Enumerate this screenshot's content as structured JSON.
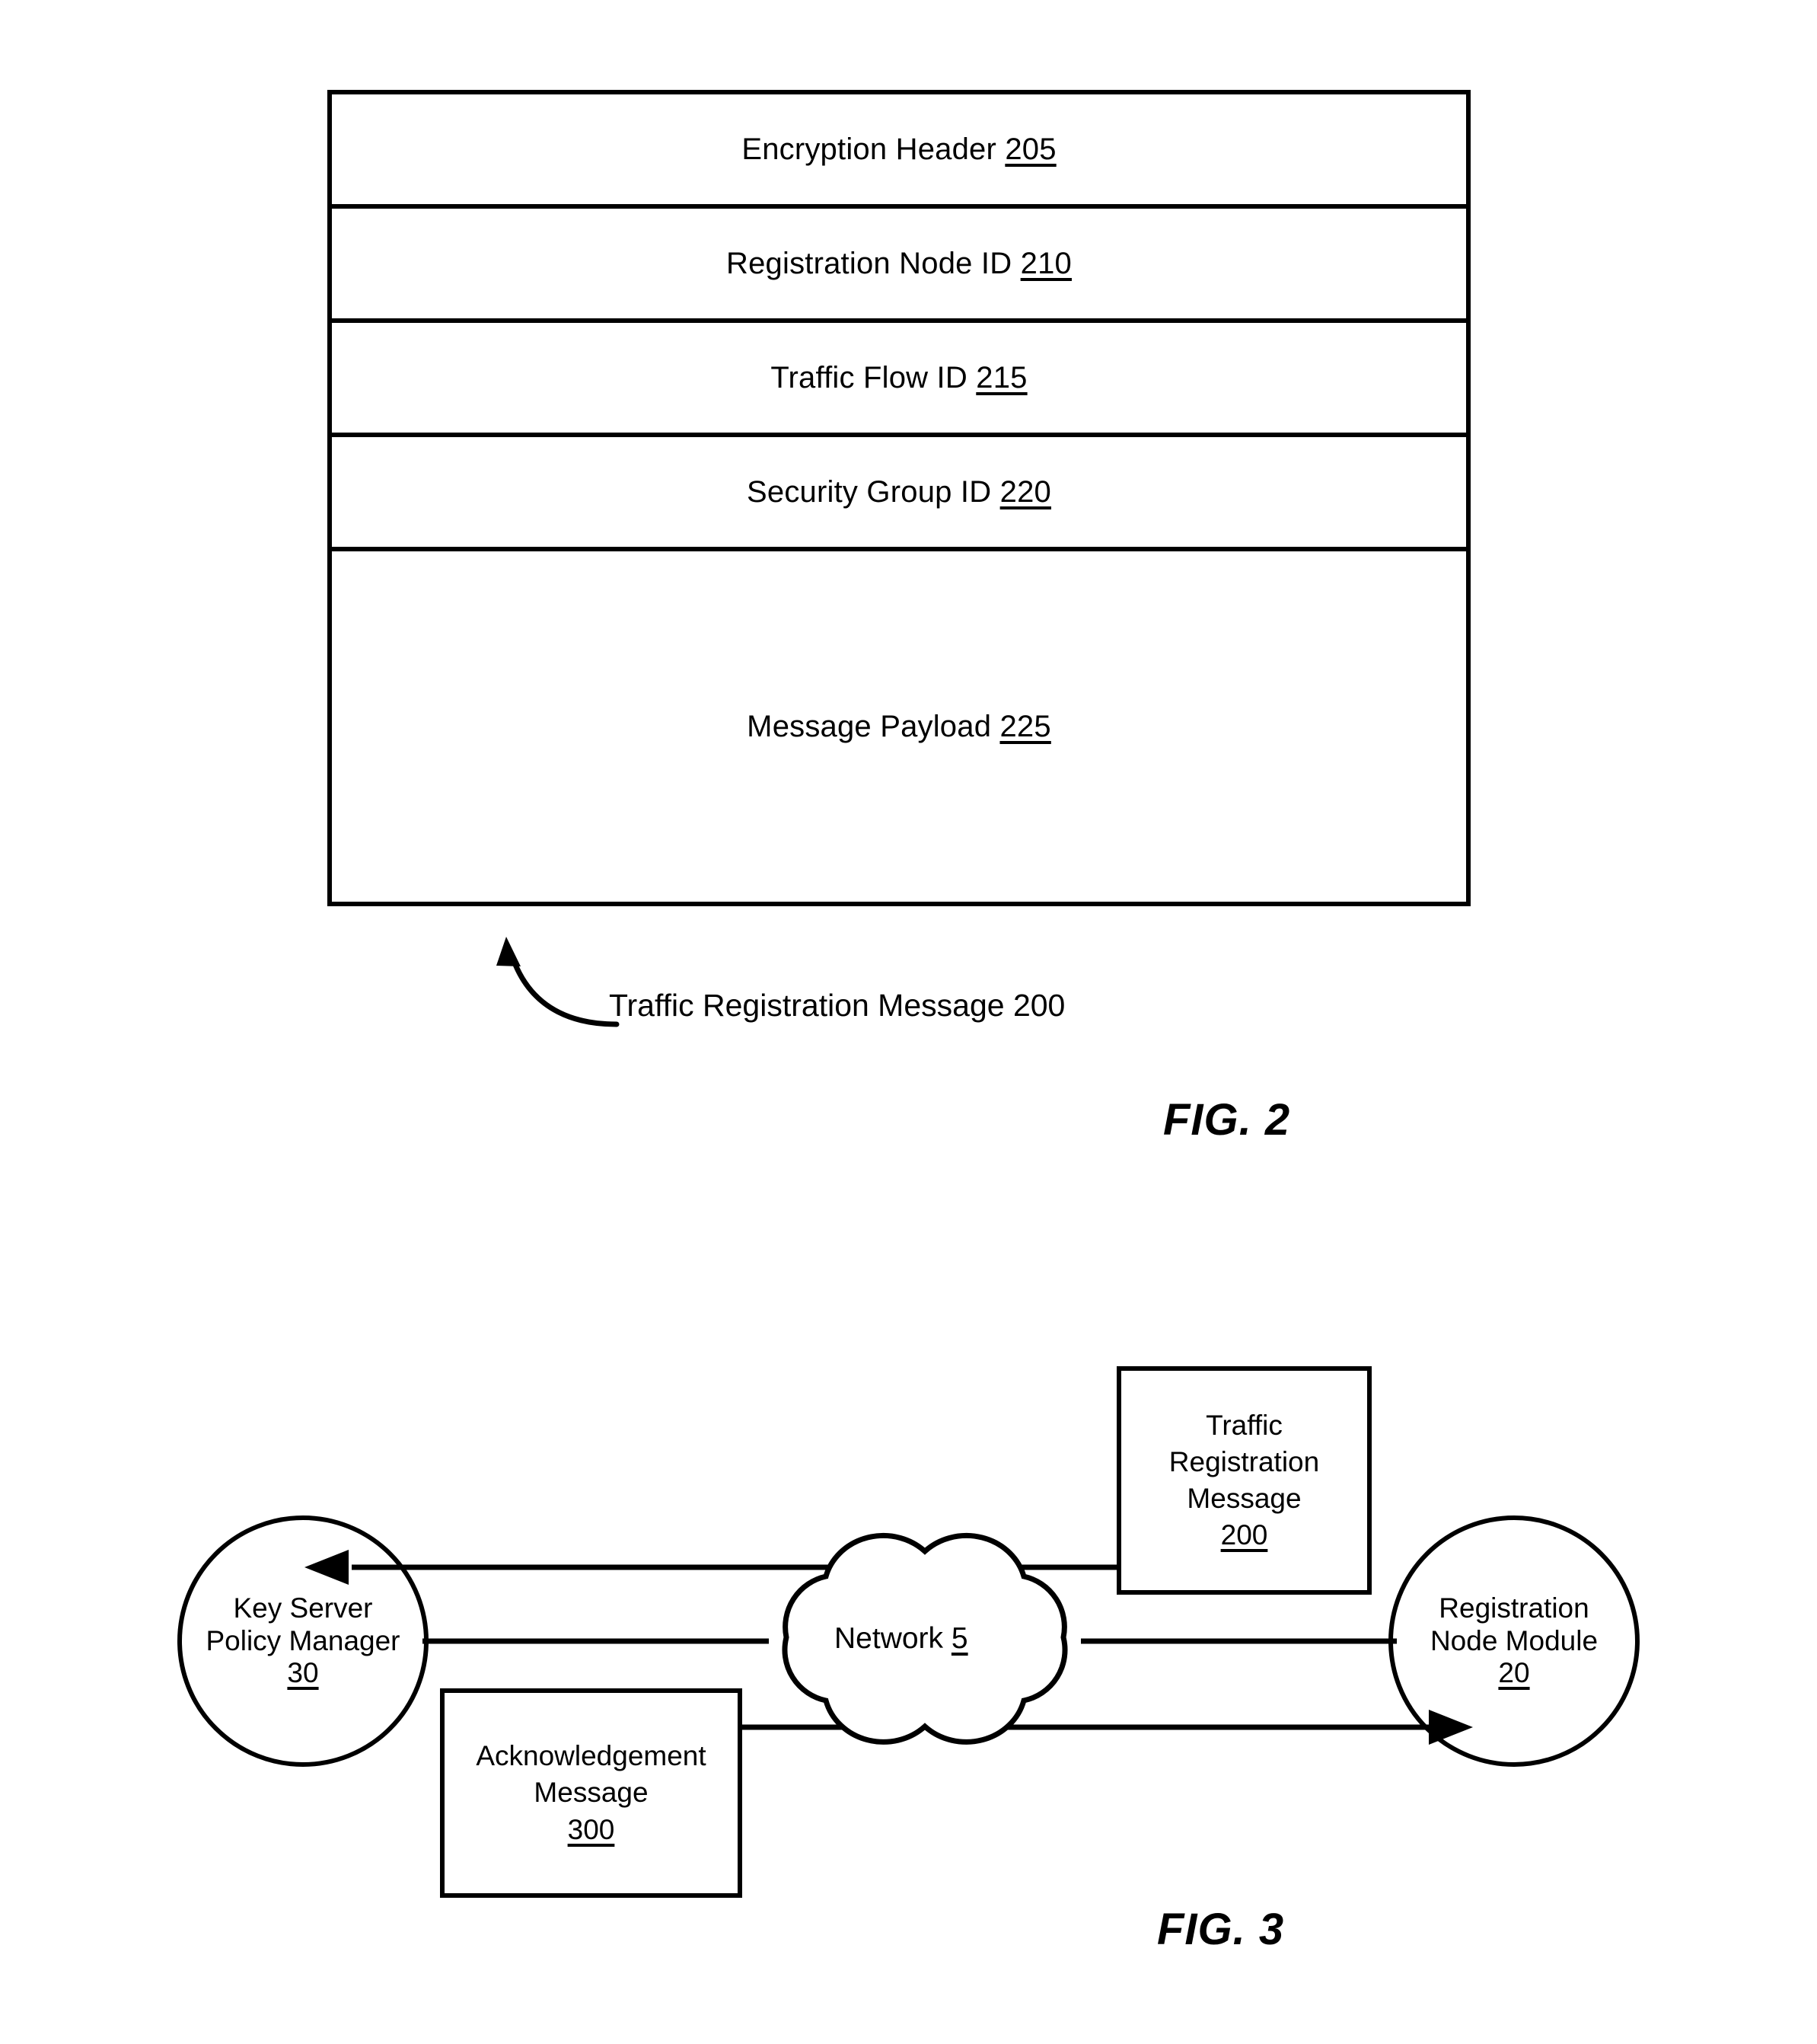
{
  "figure2": {
    "rows": [
      {
        "label": "Encryption Header",
        "ref": "205"
      },
      {
        "label": "Registration Node ID",
        "ref": "210"
      },
      {
        "label": "Traffic Flow ID",
        "ref": "215"
      },
      {
        "label": "Security Group ID",
        "ref": "220"
      },
      {
        "label": "Message Payload",
        "ref": "225"
      }
    ],
    "caption": "Traffic Registration Message 200",
    "fig_label": "FIG. 2"
  },
  "figure3": {
    "key_server": {
      "line1": "Key Server",
      "line2": "Policy Manager",
      "ref": "30"
    },
    "registration_node": {
      "line1": "Registration",
      "line2": "Node Module",
      "ref": "20"
    },
    "network": {
      "label": "Network",
      "ref": "5"
    },
    "traffic_registration_message": {
      "line1": "Traffic",
      "line2": "Registration",
      "line3": "Message",
      "ref": "200"
    },
    "acknowledgement_message": {
      "line1": "Acknowledgement",
      "line2": "Message",
      "ref": "300"
    },
    "fig_label": "FIG. 3"
  },
  "colors": {
    "ink": "#000000",
    "page": "#ffffff"
  }
}
